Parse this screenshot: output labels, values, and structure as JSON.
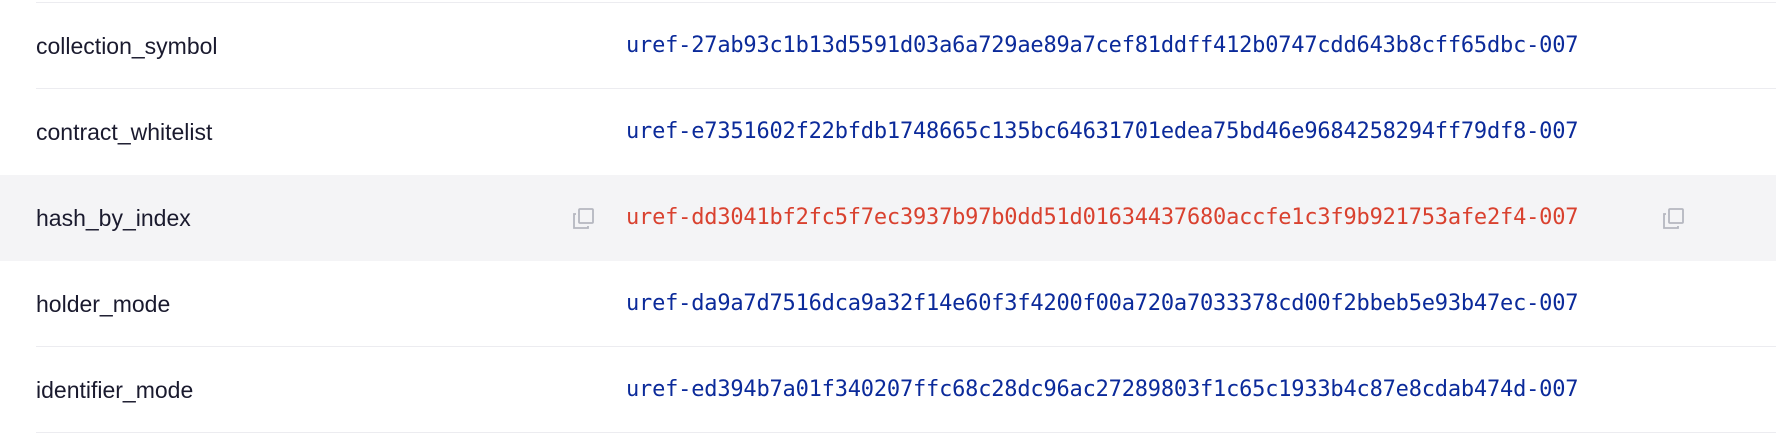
{
  "named_keys": [
    {
      "name": "collection_symbol",
      "uref": "uref-27ab93c1b13d5591d03a6a729ae89a7cef81ddff412b0747cdd643b8cff65dbc-007",
      "hovered": false
    },
    {
      "name": "contract_whitelist",
      "uref": "uref-e7351602f22bfdb1748665c135bc64631701edea75bd46e9684258294ff79df8-007",
      "hovered": false
    },
    {
      "name": "hash_by_index",
      "uref": "uref-dd3041bf2fc5f7ec3937b97b0dd51d01634437680accfe1c3f9b921753afe2f4-007",
      "hovered": true
    },
    {
      "name": "holder_mode",
      "uref": "uref-da9a7d7516dca9a32f14e60f3f4200f00a720a7033378cd00f2bbeb5e93b47ec-007",
      "hovered": false
    },
    {
      "name": "identifier_mode",
      "uref": "uref-ed394b7a01f340207ffc68c28dc96ac27289803f1c65c1933b4c87e8cdab474d-007",
      "hovered": false
    }
  ],
  "icons": {
    "copy": "copy-icon"
  },
  "colors": {
    "name_text": "#1a1a2e",
    "uref_link": "#0b2a9a",
    "uref_link_hover": "#d9412f",
    "row_hover_bg": "#f4f4f6",
    "divider": "#ececf0",
    "icon": "#b5b7c0"
  }
}
